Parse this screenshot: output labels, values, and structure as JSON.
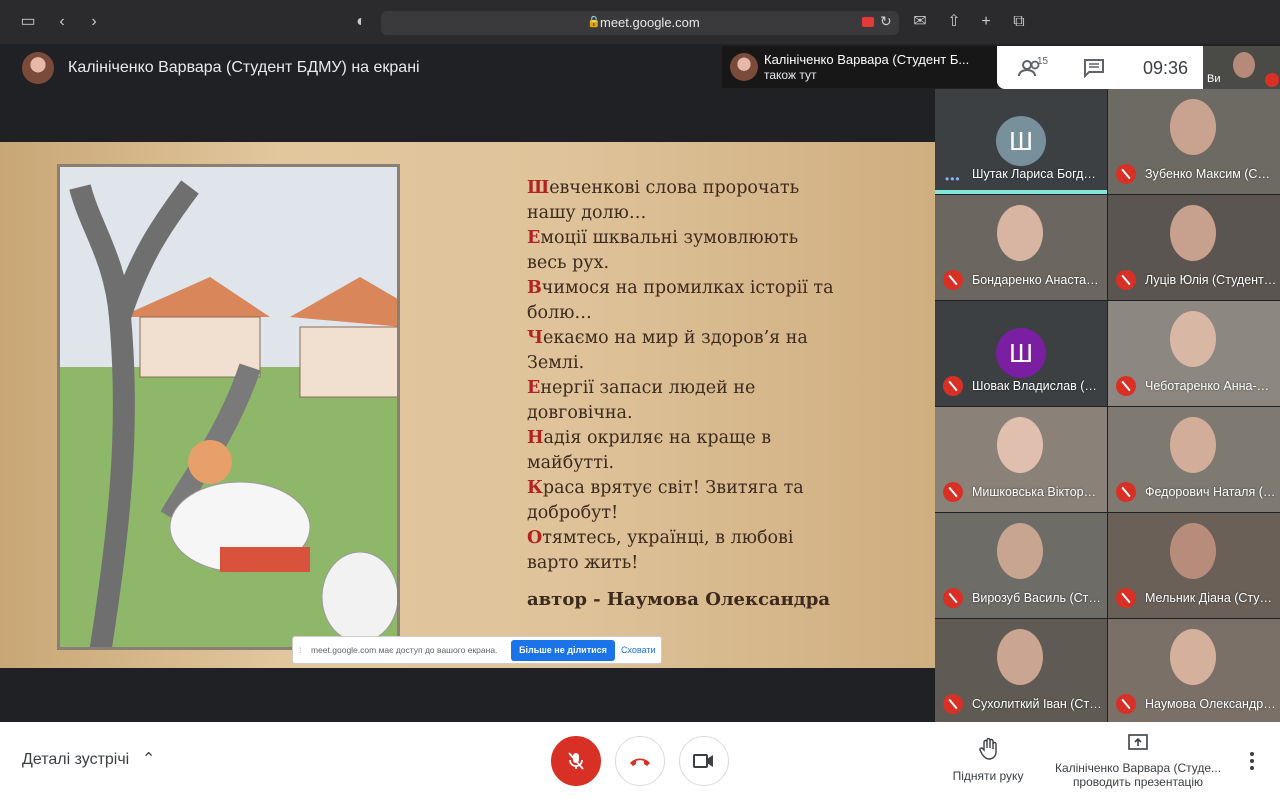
{
  "browser": {
    "url": "meet.google.com"
  },
  "header": {
    "presenter_title": "Калініченко Варвара (Студент БДМУ) на екрані",
    "also_here_name": "Калініченко Варвара (Студент Б...",
    "also_here_status": "також тут",
    "participant_count": "15",
    "time": "09:36",
    "self_label": "Ви"
  },
  "presentation": {
    "poem": [
      {
        "cap": "Ш",
        "rest": "евченкові слова пророчать"
      },
      {
        "cap": "",
        "rest": "нашу долю…"
      },
      {
        "cap": "Е",
        "rest": "моції шквальні зумовлюють"
      },
      {
        "cap": "",
        "rest": "весь рух."
      },
      {
        "cap": "В",
        "rest": "чимося на промилках історії та"
      },
      {
        "cap": "",
        "rest": "болю…"
      },
      {
        "cap": "Ч",
        "rest": "екаємо на мир й здоров’я на"
      },
      {
        "cap": "",
        "rest": "Землі."
      },
      {
        "cap": "Е",
        "rest": "нергії запаси людей не"
      },
      {
        "cap": "",
        "rest": "довговічна."
      },
      {
        "cap": "Н",
        "rest": "адія окриляє на краще в"
      },
      {
        "cap": "",
        "rest": "майбутті."
      },
      {
        "cap": "К",
        "rest": "раса врятує світ! Звитяга та"
      },
      {
        "cap": "",
        "rest": "добробут!"
      },
      {
        "cap": "О",
        "rest": "тямтесь, українці, в любові"
      },
      {
        "cap": "",
        "rest": "варто жить!"
      }
    ],
    "author": "автор - Наумова Олександра",
    "share_message": "meet.google.com має доступ до вашого екрана.",
    "stop_sharing": "Більше не ділитися",
    "hide": "Сховати"
  },
  "participants": [
    {
      "name": "Шутак Лариса Богд…",
      "initial": "Ш",
      "color": "#78909c",
      "muted": false,
      "speaking": true
    },
    {
      "name": "Зубенко Максим (С…",
      "muted": true
    },
    {
      "name": "Бондаренко Анаста…",
      "muted": true
    },
    {
      "name": "Луців Юлія (Студент…",
      "muted": true
    },
    {
      "name": "Шовак Владислав (…",
      "initial": "Ш",
      "color": "#7b1fa2",
      "muted": true
    },
    {
      "name": "Чеботаренко Анна-…",
      "muted": true
    },
    {
      "name": "Мишковська Віктор…",
      "muted": true
    },
    {
      "name": "Федорович Наталя (…",
      "muted": true
    },
    {
      "name": "Вирозуб Василь (Ст…",
      "muted": true
    },
    {
      "name": "Мельник Діана (Сту…",
      "muted": true
    },
    {
      "name": "Сухолиткий Іван (Ст…",
      "muted": true
    },
    {
      "name": "Наумова Олександр…",
      "muted": true
    }
  ],
  "bottom": {
    "details": "Деталі зустрічі",
    "raise_hand": "Підняти руку",
    "presenting_line1": "Калініченко Варвара (Студе...",
    "presenting_line2": "проводить презентацію"
  },
  "colors": {
    "accent_red": "#d93025",
    "accent_blue": "#1a73e8",
    "poem_capital": "#b32222"
  }
}
